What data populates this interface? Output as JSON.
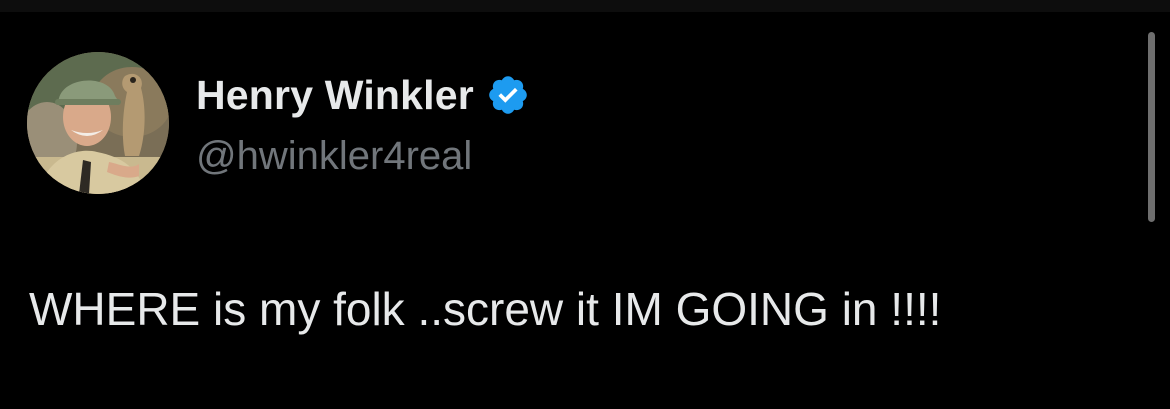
{
  "post": {
    "author": {
      "display_name": "Henry Winkler",
      "handle": "@hwinkler4real",
      "verified": true,
      "avatar_icon": "profile-photo"
    },
    "text": "WHERE is my folk ..screw it IM GOING in !!!!"
  },
  "colors": {
    "background": "#000000",
    "primary_text": "#e7e9ea",
    "secondary_text": "#71767b",
    "verified_badge": "#1d9bf0"
  },
  "icons": {
    "verified": "verified-badge-icon"
  }
}
